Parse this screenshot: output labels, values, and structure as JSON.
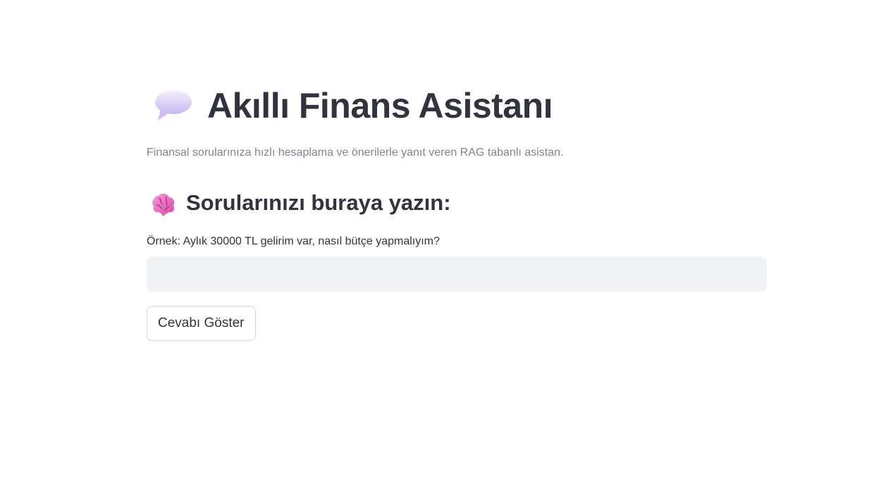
{
  "header": {
    "icon": "speech-bubble-icon",
    "title": "Akıllı Finans Asistanı",
    "subtitle": "Finansal sorularınıza hızlı hesaplama ve önerilerle yanıt veren RAG tabanlı asistan."
  },
  "question_section": {
    "icon": "brain-icon",
    "heading": "Sorularınızı buraya yazın:",
    "input_label": "Örnek: Aylık 30000 TL gelirim var, nasıl bütçe yapmalıyım?",
    "input_value": "",
    "submit_label": "Cevabı Göster"
  },
  "colors": {
    "text": "#31333f",
    "muted": "#808495",
    "input_bg": "#f0f2f6",
    "button_border": "#d6d6d9"
  }
}
